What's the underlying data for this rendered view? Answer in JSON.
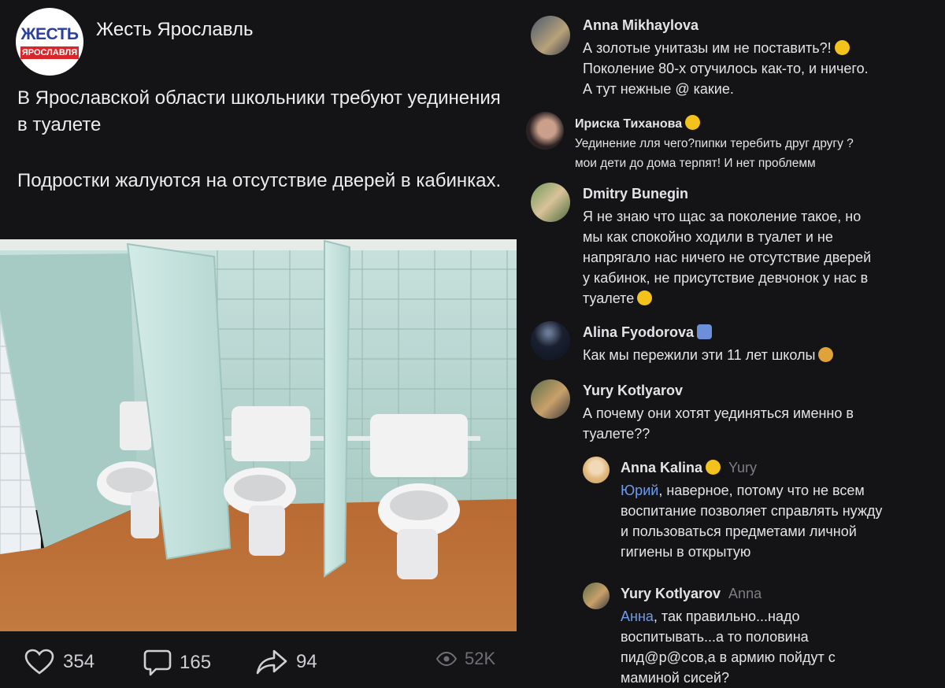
{
  "post": {
    "logo": {
      "top_text": "ЖЕСТЬ",
      "band_text": "ЯРОСЛАВЛЯ"
    },
    "author": "Жесть Ярославль",
    "paragraphs": [
      "В Ярославской области школьники требуют уединения в туалете",
      "Подростки жалуются на отсутствие дверей в кабинках."
    ],
    "actions": {
      "likes": "354",
      "comments": "165",
      "shares": "94",
      "views": "52K"
    }
  },
  "comments": [
    {
      "name": "Anna Mikhaylova",
      "lines": [
        "А золотые унитазы им не поставить?!",
        "Поколение 80-х отучилось как-то, и ничего.",
        "А тут нежные @ какие."
      ],
      "emoji": "rolling-laughing-emoji"
    },
    {
      "name": "Ириска Тиханова",
      "lines": [
        "Уединение лля чего?пипки теребить друг другу ?",
        "мои дети до дома терпят! И нет проблемм"
      ],
      "emoji": "grinning-emoji"
    },
    {
      "name": "Dmitry Bunegin",
      "lines": [
        "Я не знаю что щас за поколение такое, но",
        "мы как спокойно ходили в туалет и не",
        "напрягало нас ничего не отсутствие дверей",
        "у кабинок, не присутствие девчонок у нас в",
        "туалете"
      ],
      "emoji": "grinning-emoji"
    },
    {
      "name": "Alina Fyodorova",
      "lines": [
        "Как мы пережили эти 11 лет школы"
      ],
      "emoji": "shrug-emoji"
    },
    {
      "name": "Yury Kotlyarov",
      "lines": [
        "А почему они хотят уединяться именно в",
        "туалете??"
      ]
    },
    {
      "name": "Anna Kalina",
      "reply_to": "Yury",
      "mention": "Юрий",
      "lines": [
        ", наверное, потому что не всем",
        "воспитание позволяет справлять нужду",
        "и пользоваться предметами личной",
        "гигиены в открытую"
      ]
    },
    {
      "name": "Yury Kotlyarov",
      "reply_to": "Anna",
      "mention": "Анна",
      "lines": [
        ", так правильно...надо",
        "воспитывать...а то половина",
        "пид@р@сов,а в армию пойдут с",
        "маминой сисей?"
      ]
    }
  ]
}
